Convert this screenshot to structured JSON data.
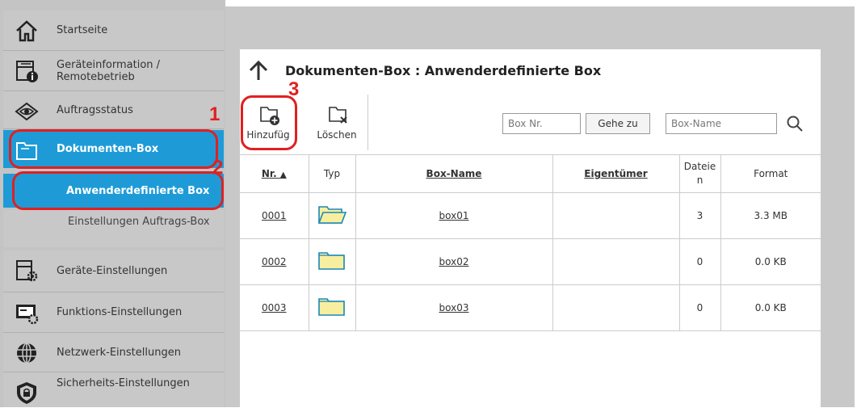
{
  "sidebar": {
    "items": [
      {
        "label": "Startseite",
        "icon": "home-icon"
      },
      {
        "label": "Geräteinformation / Remotebetrieb",
        "icon": "device-info-icon"
      },
      {
        "label": "Auftragsstatus",
        "icon": "eye-icon"
      },
      {
        "label": "Dokumenten-Box",
        "icon": "folder-icon",
        "active": true
      },
      {
        "label": "Geräte-Einstellungen",
        "icon": "device-settings-icon"
      },
      {
        "label": "Funktions-Einstellungen",
        "icon": "function-settings-icon"
      },
      {
        "label": "Netzwerk-Einstellungen",
        "icon": "globe-icon"
      },
      {
        "label": "Sicherheits-Einstellungen",
        "icon": "shield-icon"
      }
    ],
    "subitems": [
      {
        "label": "Anwenderdefinierte Box",
        "active": true
      },
      {
        "label": "Einstellungen Auftrags-Box"
      }
    ]
  },
  "callouts": [
    "1",
    "2",
    "3"
  ],
  "main": {
    "title": "Dokumenten-Box : Anwenderdefinierte Box",
    "toolbar": {
      "add_label": "Hinzufüg",
      "delete_label": "Löschen",
      "box_nr_placeholder": "Box Nr.",
      "goto_label": "Gehe zu",
      "box_name_placeholder": "Box-Name"
    },
    "table": {
      "headers": {
        "nr": "Nr.",
        "type": "Typ",
        "name": "Box-Name",
        "owner": "Eigentümer",
        "files": "Dateie n",
        "format": "Format"
      },
      "sort_indicator": "▲",
      "rows": [
        {
          "nr": "0001",
          "name": "box01",
          "owner": "",
          "files": "3",
          "format": "3.3 MB",
          "open": true
        },
        {
          "nr": "0002",
          "name": "box02",
          "owner": "",
          "files": "0",
          "format": "0.0 KB",
          "open": false
        },
        {
          "nr": "0003",
          "name": "box03",
          "owner": "",
          "files": "0",
          "format": "0.0 KB",
          "open": false
        }
      ]
    }
  },
  "colors": {
    "accent": "#1e9bd7",
    "callout": "#e02020",
    "sidebar_bg": "#c8c8c8",
    "folder": "#f7ef9f"
  }
}
